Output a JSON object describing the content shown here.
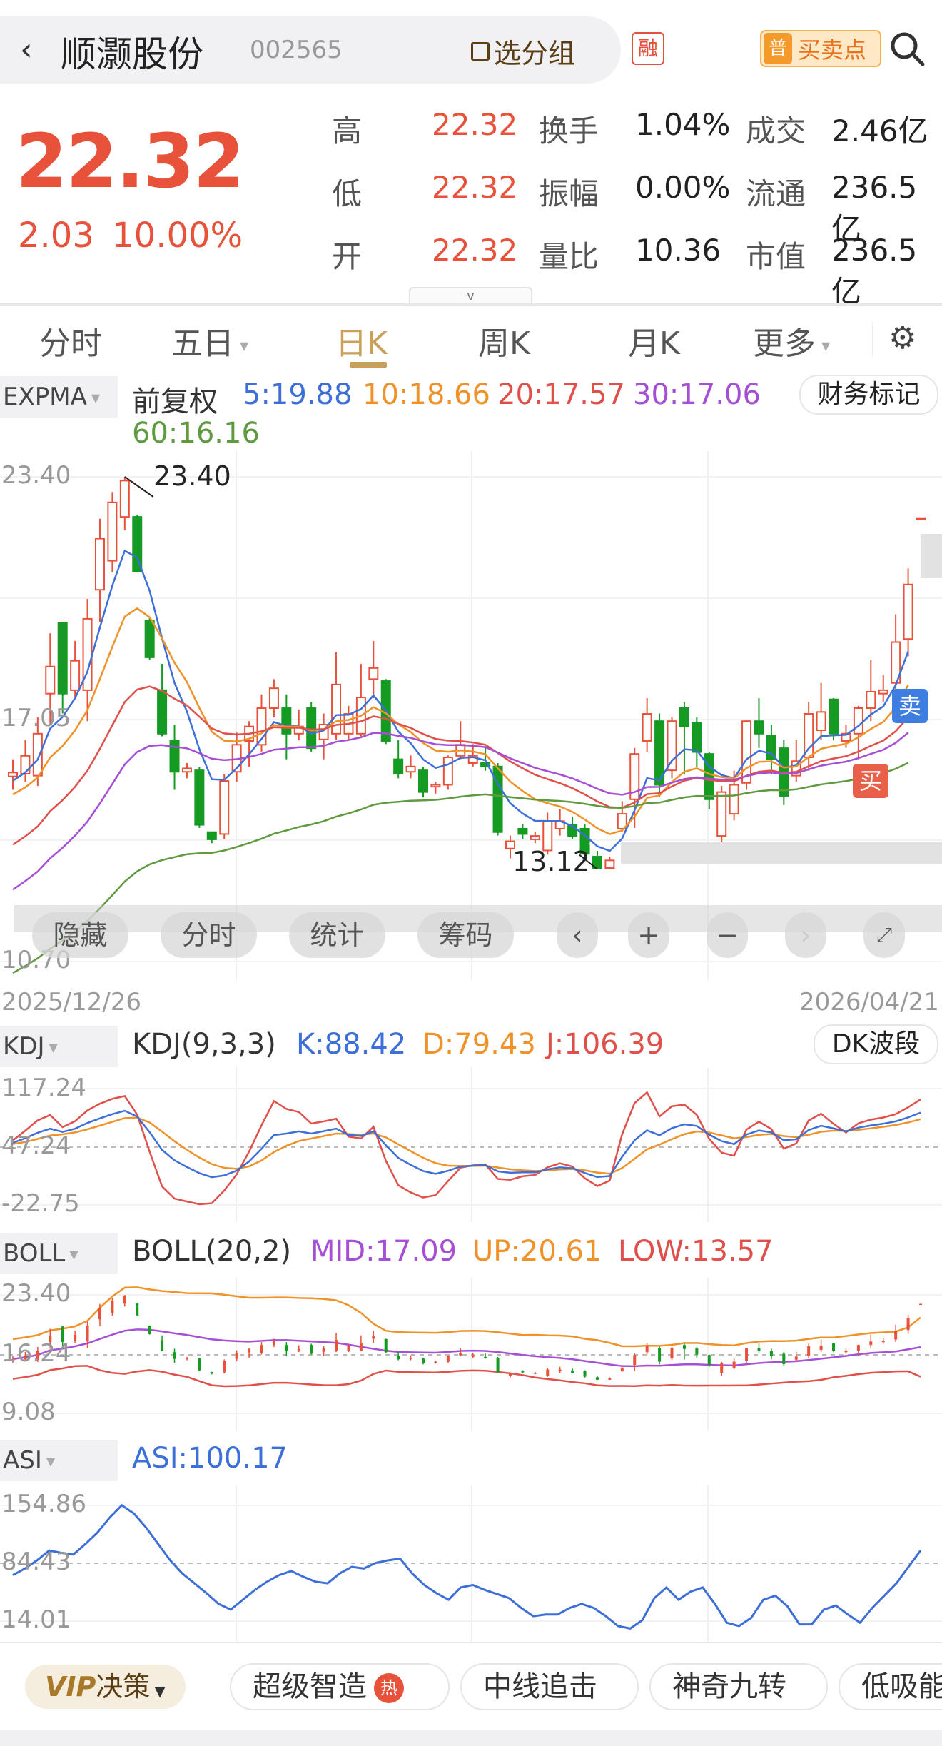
{
  "header": {
    "title": "顺灏股份",
    "code": "002565",
    "group_label": "选分组",
    "rong_badge": "融",
    "buy_sell_badge_icon": "普",
    "buy_sell_label": "买卖点"
  },
  "quote": {
    "price": "22.32",
    "change": "2.03",
    "change_pct": "10.00%",
    "stats": [
      [
        {
          "label": "高",
          "value": "22.32"
        },
        {
          "label": "换手",
          "value": "1.04%"
        },
        {
          "label": "成交",
          "value": "2.46亿"
        }
      ],
      [
        {
          "label": "低",
          "value": "22.32"
        },
        {
          "label": "振幅",
          "value": "0.00%"
        },
        {
          "label": "流通",
          "value": "236.5亿"
        }
      ],
      [
        {
          "label": "开",
          "value": "22.32"
        },
        {
          "label": "量比",
          "value": "10.36"
        },
        {
          "label": "市值",
          "value": "236.5亿"
        }
      ]
    ],
    "expand_icon": "v"
  },
  "tabs": [
    "分时",
    "五日",
    "日K",
    "周K",
    "月K",
    "更多"
  ],
  "active_tab": "日K",
  "main_indicator": {
    "name": "EXPMA",
    "adjust": "前复权",
    "lines": [
      {
        "label": "5:19.88",
        "period": 5,
        "color": "#3d6fd8",
        "seed": 15.33
      },
      {
        "label": "10:18.66",
        "period": 10,
        "color": "#f0922a",
        "seed": 14.95
      },
      {
        "label": "20:17.57",
        "period": 20,
        "color": "#e0504a",
        "seed": 13.56
      },
      {
        "label": "30:17.06",
        "period": 30,
        "color": "#a74ed6",
        "seed": 12.37
      },
      {
        "label": "60:16.16",
        "period": 60,
        "color": "#5f9a3e",
        "seed": 10.22
      }
    ],
    "finance_button": "财务标记"
  },
  "chart_data": {
    "type": "candlestick",
    "y_ticks": [
      "23.40",
      "17.05",
      "10.70"
    ],
    "ylim": [
      10.7,
      23.4
    ],
    "high_label": "23.40",
    "low_label": "13.12",
    "start_date": "2025/12/26",
    "end_date": "2026/04/21",
    "up_color": "#e8523a",
    "down_color": "#159a22",
    "candles": [
      [
        15.55,
        15.65,
        16.0,
        15.2
      ],
      [
        15.62,
        16.09,
        16.5,
        15.4
      ],
      [
        15.57,
        16.67,
        17.1,
        15.3
      ],
      [
        17.72,
        18.43,
        19.3,
        16.9
      ],
      [
        19.58,
        17.72,
        19.6,
        17.2
      ],
      [
        17.81,
        18.58,
        19.1,
        17.6
      ],
      [
        17.81,
        19.68,
        20.2,
        17.0
      ],
      [
        20.44,
        21.78,
        22.3,
        19.6
      ],
      [
        21.2,
        22.73,
        23.0,
        20.9
      ],
      [
        22.35,
        23.3,
        23.4,
        22.0
      ],
      [
        22.35,
        20.92,
        22.4,
        20.9
      ],
      [
        19.63,
        18.67,
        19.7,
        18.6
      ],
      [
        17.81,
        16.67,
        18.5,
        16.6
      ],
      [
        16.48,
        15.67,
        16.9,
        15.2
      ],
      [
        15.67,
        15.76,
        15.9,
        15.5
      ],
      [
        15.71,
        14.28,
        15.8,
        14.2
      ],
      [
        14.09,
        13.9,
        14.1,
        13.8
      ],
      [
        14.04,
        15.43,
        15.6,
        13.9
      ],
      [
        15.67,
        16.38,
        16.7,
        15.4
      ],
      [
        16.48,
        16.86,
        17.0,
        15.8
      ],
      [
        16.38,
        17.34,
        17.7,
        16.2
      ],
      [
        17.34,
        17.86,
        18.1,
        17.1
      ],
      [
        17.34,
        16.67,
        17.7,
        16.0
      ],
      [
        16.67,
        16.86,
        17.3,
        16.5
      ],
      [
        17.34,
        16.29,
        17.5,
        16.2
      ],
      [
        16.52,
        16.91,
        17.2,
        16.0
      ],
      [
        16.67,
        17.96,
        18.8,
        16.5
      ],
      [
        16.67,
        17.19,
        17.4,
        16.5
      ],
      [
        16.67,
        17.62,
        18.5,
        16.6
      ],
      [
        18.1,
        18.39,
        19.1,
        17.6
      ],
      [
        18.05,
        16.48,
        18.1,
        16.4
      ],
      [
        16.0,
        15.62,
        16.5,
        15.5
      ],
      [
        15.67,
        15.81,
        16.1,
        15.5
      ],
      [
        15.71,
        15.14,
        15.8,
        15.0
      ],
      [
        15.28,
        15.33,
        15.4,
        15.1
      ],
      [
        15.33,
        16.05,
        16.1,
        15.2
      ],
      [
        16.09,
        16.38,
        17.0,
        16.0
      ],
      [
        15.9,
        16.09,
        16.4,
        15.8
      ],
      [
        15.9,
        15.81,
        16.3,
        15.7
      ],
      [
        15.81,
        14.09,
        15.9,
        14.0
      ],
      [
        13.66,
        13.85,
        14.0,
        13.4
      ],
      [
        14.18,
        14.04,
        14.3,
        13.9
      ],
      [
        13.9,
        13.99,
        14.1,
        13.8
      ],
      [
        13.61,
        14.38,
        14.6,
        13.5
      ],
      [
        14.18,
        14.38,
        14.7,
        14.0
      ],
      [
        14.28,
        13.99,
        14.5,
        13.9
      ],
      [
        14.18,
        13.52,
        14.3,
        13.4
      ],
      [
        13.45,
        13.15,
        13.6,
        13.12
      ],
      [
        13.15,
        13.35,
        13.45,
        13.12
      ],
      [
        14.18,
        14.57,
        14.9,
        14.1
      ],
      [
        14.95,
        16.14,
        16.3,
        14.2
      ],
      [
        16.48,
        17.19,
        17.6,
        16.2
      ],
      [
        17.0,
        15.33,
        17.2,
        15.0
      ],
      [
        15.71,
        17.0,
        17.1,
        15.5
      ],
      [
        17.34,
        16.86,
        17.5,
        15.6
      ],
      [
        16.95,
        16.19,
        17.1,
        15.8
      ],
      [
        16.14,
        14.95,
        16.2,
        14.7
      ],
      [
        13.99,
        15.14,
        15.3,
        13.6
      ],
      [
        14.57,
        15.33,
        15.7,
        14.4
      ],
      [
        15.38,
        17.0,
        17.0,
        15.2
      ],
      [
        17.0,
        16.67,
        17.6,
        16.3
      ],
      [
        16.62,
        16.0,
        16.9,
        15.6
      ],
      [
        16.29,
        15.04,
        16.5,
        14.8
      ],
      [
        15.57,
        15.95,
        16.5,
        15.4
      ],
      [
        16.05,
        17.19,
        17.5,
        15.7
      ],
      [
        16.76,
        17.24,
        18.0,
        16.5
      ],
      [
        17.57,
        16.67,
        17.6,
        16.5
      ],
      [
        16.48,
        16.67,
        16.9,
        16.3
      ],
      [
        16.67,
        17.34,
        17.4,
        16.0
      ],
      [
        17.34,
        17.77,
        18.6,
        17.0
      ],
      [
        17.72,
        17.81,
        18.2,
        17.5
      ],
      [
        18.0,
        19.07,
        19.8,
        17.7
      ],
      [
        19.15,
        20.58,
        21.0,
        18.7
      ],
      [
        22.32,
        22.32,
        22.32,
        22.32
      ]
    ],
    "signals": [
      {
        "label": "卖",
        "color": "#3d7ee0"
      },
      {
        "label": "买",
        "color": "#e8604a"
      }
    ]
  },
  "toolbar": {
    "hide": "隐藏",
    "intraday": "分时",
    "stats": "统计",
    "chips": "筹码",
    "prev": "‹",
    "zoom_in": "+",
    "zoom_out": "−",
    "next": "›"
  },
  "kdj": {
    "name": "KDJ",
    "params": "KDJ(9,3,3)",
    "k": "K:88.42",
    "d": "D:79.43",
    "j": "J:106.39",
    "ticks": [
      "117.24",
      "47.24",
      "-22.75"
    ],
    "ylim": [
      -22.75,
      117.24
    ],
    "band_button": "DK波段"
  },
  "boll": {
    "name": "BOLL",
    "params": "BOLL(20,2)",
    "mid": "MID:17.09",
    "up": "UP:20.61",
    "low": "LOW:13.57",
    "ticks": [
      "23.40",
      "16.24",
      "9.08"
    ],
    "ylim": [
      9.08,
      23.4
    ]
  },
  "asi": {
    "name": "ASI",
    "value": "ASI:100.17",
    "ticks": [
      "154.86",
      "84.43",
      "14.01"
    ],
    "ylim": [
      14.01,
      154.86
    ],
    "values": [
      70,
      78,
      88,
      100,
      97,
      95,
      108,
      122,
      140,
      155,
      145,
      128,
      108,
      88,
      72,
      60,
      48,
      35,
      28,
      40,
      52,
      62,
      70,
      75,
      68,
      62,
      60,
      72,
      80,
      78,
      85,
      88,
      90,
      72,
      58,
      48,
      40,
      55,
      58,
      52,
      47,
      42,
      30,
      20,
      22,
      22,
      30,
      35,
      30,
      20,
      8,
      5,
      15,
      42,
      55,
      40,
      50,
      55,
      35,
      12,
      8,
      18,
      40,
      45,
      32,
      10,
      10,
      28,
      33,
      22,
      12,
      30,
      45,
      60,
      80,
      100
    ]
  },
  "bottom_chips": {
    "vip": "VIP",
    "vip_label": "决策",
    "items": [
      "超级智造",
      "中线追击",
      "神奇九转",
      "低吸能"
    ],
    "hot": "热"
  }
}
